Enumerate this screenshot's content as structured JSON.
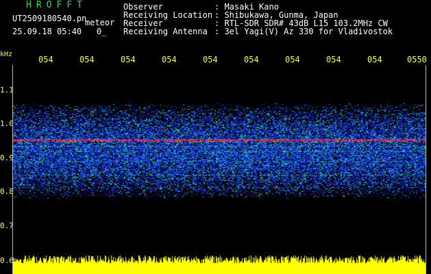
{
  "header": {
    "brand": "HROFFT",
    "filename": "UT2509180540.pn",
    "tag": "meteor",
    "datetime": "25.09.18 05:40   0_"
  },
  "meta": [
    {
      "label": "Observer",
      "value": "Masaki Kano"
    },
    {
      "label": "Receiving Location",
      "value": "Shibukawa, Gunma, Japan"
    },
    {
      "label": "Receiver",
      "value": "RTL-SDR SDR# 43dB L15 103.2MHz CW"
    },
    {
      "label": "Receiving Antenna",
      "value": "3el Yagi(V) Az 330 for Vladivostok"
    }
  ],
  "axis": {
    "y_unit": "kHz",
    "y_ticks": [
      "1.1",
      "1.0",
      "0.9",
      "0.8",
      "0.7",
      "0.6"
    ],
    "x_ticks": [
      "054",
      "054",
      "054",
      "054",
      "054",
      "054",
      "054",
      "054",
      "054",
      "0550"
    ]
  },
  "colors": {
    "background": "#000000",
    "brand": "#33dd33",
    "axis_labels": "#ffff33",
    "signal_bar": "#ffff00"
  }
}
